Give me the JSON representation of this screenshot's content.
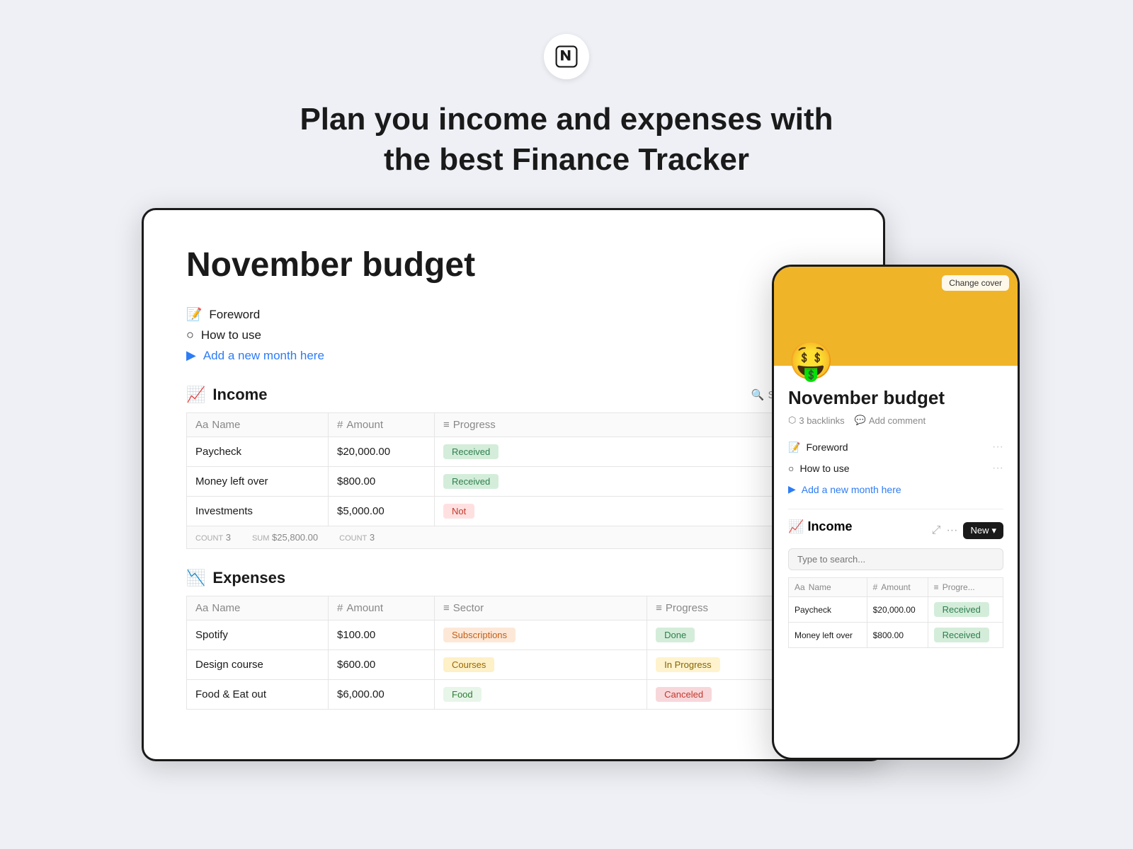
{
  "header": {
    "logo_alt": "Notion logo",
    "headline_line1": "Plan you income and expenses with",
    "headline_line2": "the best Finance Tracker"
  },
  "desktop": {
    "page_title": "November budget",
    "nav": [
      {
        "icon": "📝",
        "label": "Foreword",
        "type": "normal"
      },
      {
        "icon": "○",
        "label": "How to use",
        "type": "normal"
      },
      {
        "icon": "▶",
        "label": "Add a new month here",
        "type": "blue"
      }
    ],
    "income_section": {
      "icon": "📈",
      "title": "Income",
      "search_label": "Search",
      "columns": [
        {
          "type": "text",
          "icon": "Aa",
          "label": "Name"
        },
        {
          "type": "number",
          "icon": "#",
          "label": "Amount"
        },
        {
          "type": "select",
          "icon": "≡",
          "label": "Progress"
        }
      ],
      "rows": [
        {
          "name": "Paycheck",
          "amount": "$20,000.00",
          "progress": "Received",
          "badge": "received"
        },
        {
          "name": "Money left over",
          "amount": "$800.00",
          "progress": "Received",
          "badge": "received"
        },
        {
          "name": "Investments",
          "amount": "$5,000.00",
          "progress": "Not",
          "badge": "not"
        }
      ],
      "footer": {
        "count_label": "COUNT",
        "count": "3",
        "sum_label": "SUM",
        "sum": "$25,800.00",
        "count2_label": "COUNT",
        "count2": "3"
      }
    },
    "expenses_section": {
      "icon": "📉",
      "title": "Expenses",
      "columns": [
        {
          "type": "text",
          "icon": "Aa",
          "label": "Name"
        },
        {
          "type": "number",
          "icon": "#",
          "label": "Amount"
        },
        {
          "type": "select",
          "icon": "≡",
          "label": "Sector"
        },
        {
          "type": "select",
          "icon": "≡",
          "label": "Progress"
        }
      ],
      "rows": [
        {
          "name": "Spotify",
          "amount": "$100.00",
          "sector": "Subscriptions",
          "sector_badge": "sub",
          "progress": "Done",
          "badge": "done"
        },
        {
          "name": "Design course",
          "amount": "$600.00",
          "sector": "Courses",
          "sector_badge": "courses",
          "progress": "In Progress",
          "badge": "inprogress"
        },
        {
          "name": "Food & Eat out",
          "amount": "$6,000.00",
          "sector": "Food",
          "sector_badge": "food",
          "progress": "Canceled",
          "badge": "canceled"
        }
      ]
    }
  },
  "mobile": {
    "cover_emoji": "🤑",
    "change_cover_label": "Change cover",
    "page_title": "November budget",
    "backlinks_label": "3 backlinks",
    "comment_label": "Add comment",
    "nav": [
      {
        "icon": "📝",
        "label": "Foreword",
        "type": "normal"
      },
      {
        "icon": "○",
        "label": "How to use",
        "type": "normal"
      },
      {
        "icon": "▶",
        "label": "Add a new month here",
        "type": "blue"
      }
    ],
    "income_section": {
      "icon": "📈",
      "title": "Income",
      "new_label": "New",
      "search_placeholder": "Type to search...",
      "columns": [
        {
          "icon": "Aa",
          "label": "Name"
        },
        {
          "icon": "#",
          "label": "Amount"
        },
        {
          "icon": "≡",
          "label": "Progre..."
        }
      ],
      "rows": [
        {
          "name": "Paycheck",
          "amount": "$20,000.00",
          "progress": "Received",
          "badge": "received"
        },
        {
          "name": "Money left over",
          "amount": "$800.00",
          "progress": "Received",
          "badge": "received"
        }
      ]
    },
    "extra_labels": {
      "in_progress": "In Progress",
      "canceled": "Canceled",
      "money_left_over": "Money left over",
      "amount": "Amount",
      "how_to_use": "How to use",
      "new": "New"
    }
  }
}
